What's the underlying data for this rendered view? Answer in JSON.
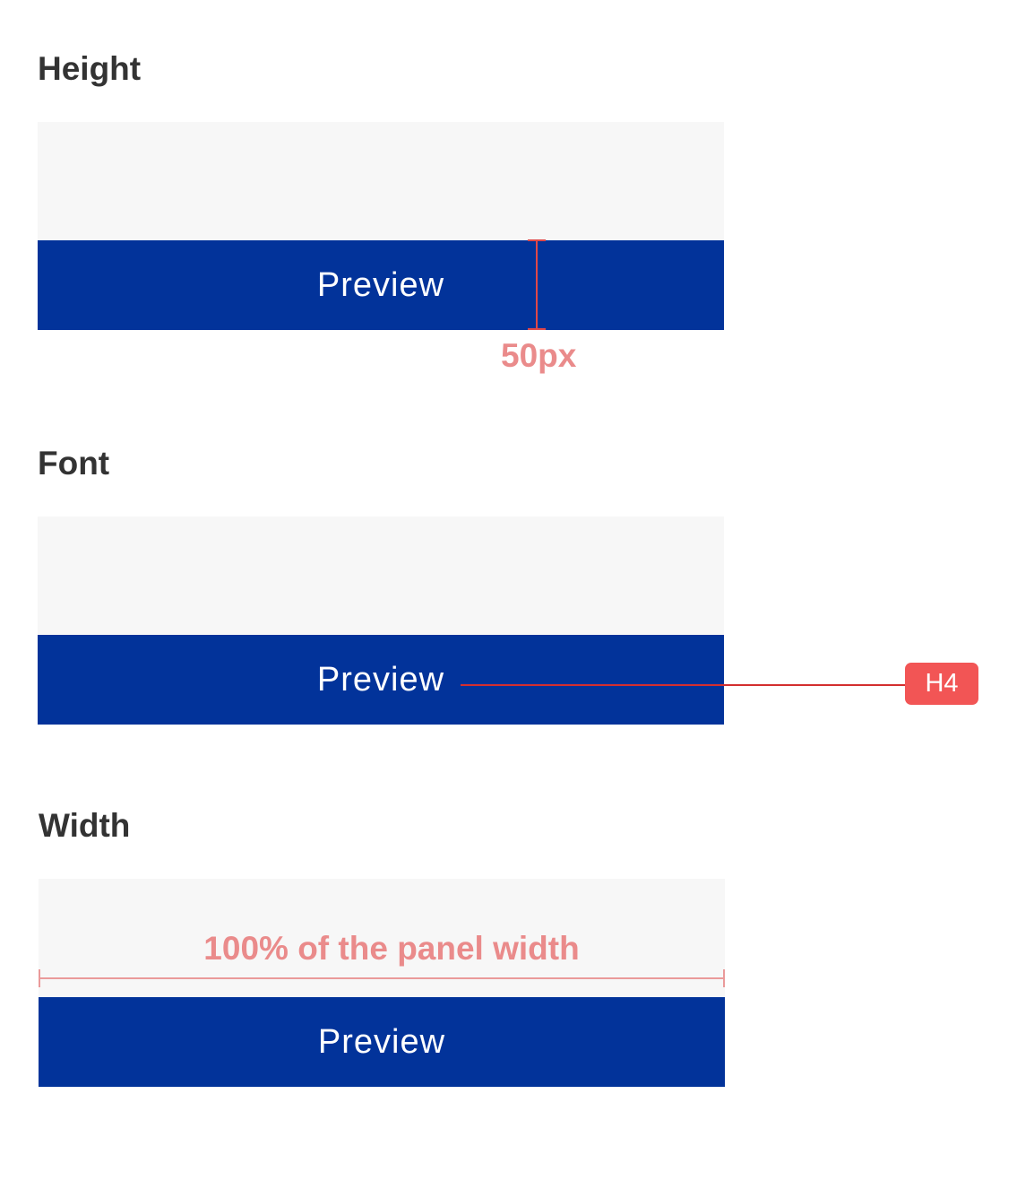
{
  "sections": {
    "height": {
      "title": "Height",
      "button_label": "Preview",
      "measurement": "50px"
    },
    "font": {
      "title": "Font",
      "button_label": "Preview",
      "tag": "H4"
    },
    "width": {
      "title": "Width",
      "button_label": "Preview",
      "measurement": "100% of the panel width"
    }
  },
  "colors": {
    "button_background": "#02339a",
    "button_text": "#ffffff",
    "panel_background": "#f7f7f7",
    "annotation": "#ea8b8b",
    "annotation_line": "#e04848",
    "tag_background": "#f25555",
    "heading": "#333333"
  }
}
